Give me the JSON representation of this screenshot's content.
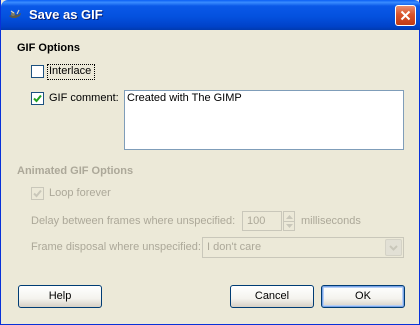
{
  "window": {
    "title": "Save as GIF"
  },
  "gif_options": {
    "heading": "GIF Options",
    "interlace": {
      "label": "Interlace",
      "checked": false
    },
    "gif_comment": {
      "label": "GIF comment:",
      "checked": true,
      "value": "Created with The GIMP"
    }
  },
  "animated_options": {
    "heading": "Animated GIF Options",
    "loop_forever": {
      "label": "Loop forever",
      "checked": true
    },
    "delay": {
      "label": "Delay between frames where unspecified:",
      "value": "100",
      "unit": "milliseconds"
    },
    "disposal": {
      "label": "Frame disposal where unspecified:",
      "selected": "I don't care"
    }
  },
  "buttons": {
    "help": "Help",
    "cancel": "Cancel",
    "ok": "OK"
  },
  "colors": {
    "titlebar": "#0451de",
    "window_bg": "#ece9d8",
    "disabled_text": "#aca899"
  }
}
